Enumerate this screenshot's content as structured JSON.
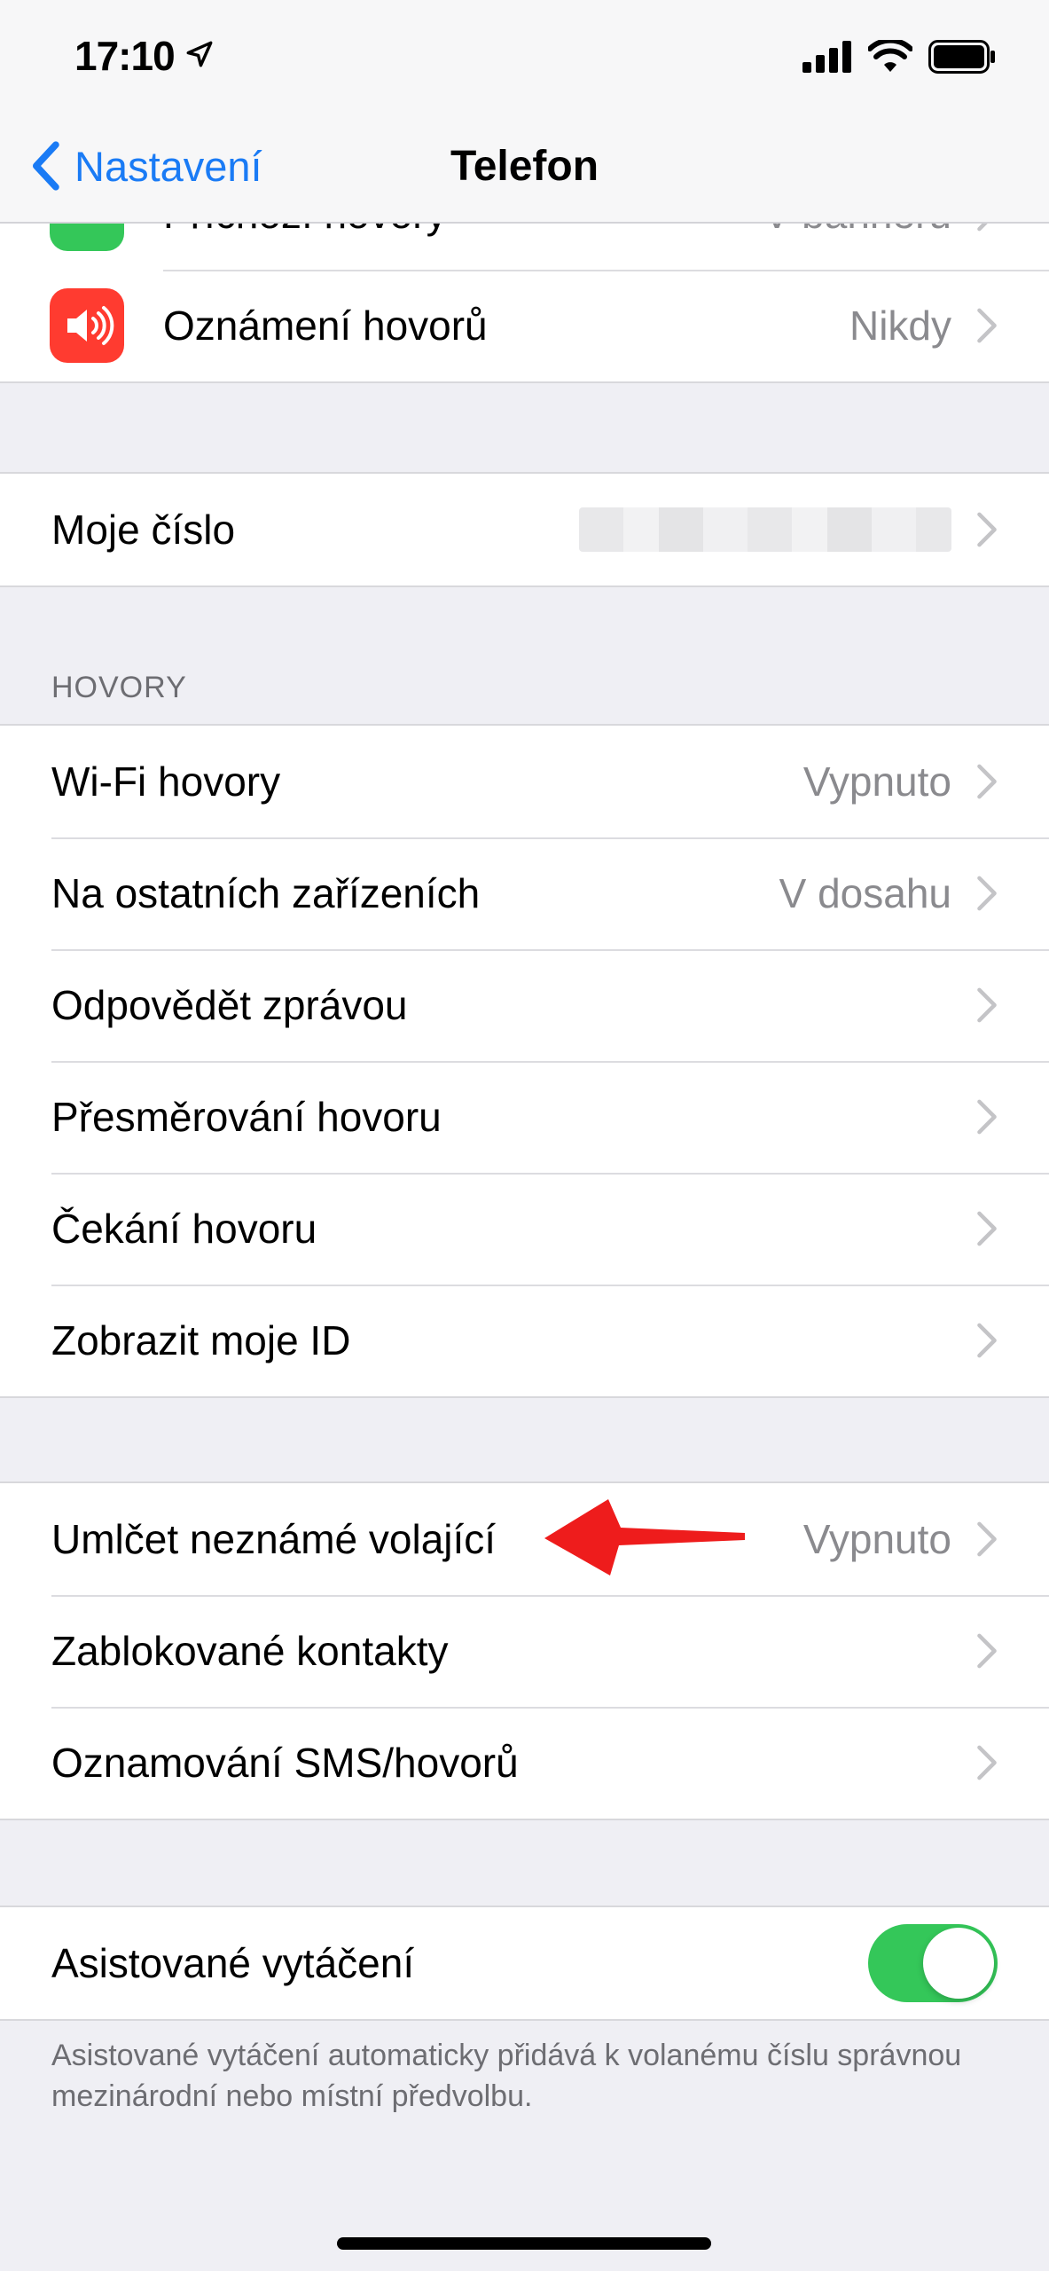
{
  "status_bar": {
    "time": "17:10"
  },
  "nav": {
    "back_label": "Nastavení",
    "title": "Telefon"
  },
  "top_group": [
    {
      "label": "Příchozí hovory",
      "value": "V banneru",
      "icon": "phone-icon",
      "icon_color": "#34c759"
    },
    {
      "label": "Oznámení hovorů",
      "value": "Nikdy",
      "icon": "speaker-icon",
      "icon_color": "#ff3b30"
    }
  ],
  "my_number": {
    "label": "Moje číslo"
  },
  "calls_section": {
    "header": "HOVORY",
    "rows": [
      {
        "label": "Wi-Fi hovory",
        "value": "Vypnuto"
      },
      {
        "label": "Na ostatních zařízeních",
        "value": "V dosahu"
      },
      {
        "label": "Odpovědět zprávou",
        "value": ""
      },
      {
        "label": "Přesměrování hovoru",
        "value": ""
      },
      {
        "label": "Čekání hovoru",
        "value": ""
      },
      {
        "label": "Zobrazit moje ID",
        "value": ""
      }
    ]
  },
  "block_section": {
    "rows": [
      {
        "label": "Umlčet neznámé volající",
        "value": "Vypnuto"
      },
      {
        "label": "Zablokované kontakty",
        "value": ""
      },
      {
        "label": "Oznamování SMS/hovorů",
        "value": ""
      }
    ]
  },
  "dial_assist": {
    "label": "Asistované vytáčení",
    "enabled": true,
    "footer": "Asistované vytáčení automaticky přidává k volanému číslu správnou mezinárodní nebo místní předvolbu."
  },
  "colors": {
    "accent": "#1a7bf5",
    "toggle_on": "#34c759",
    "annotation_arrow": "#ee1c1c"
  }
}
